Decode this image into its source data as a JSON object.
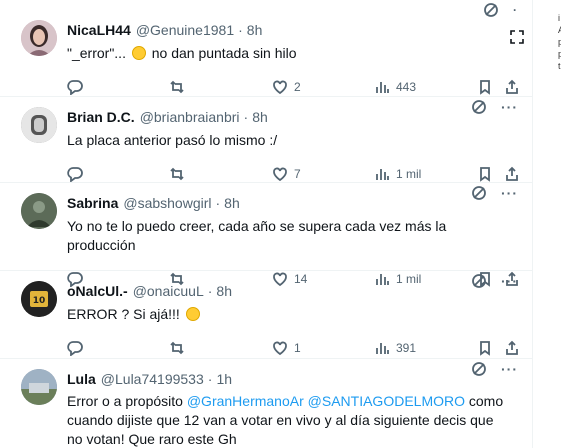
{
  "tweets": [
    {
      "name": "NicaLH44",
      "handle": "@Genuine1981",
      "time": "8h",
      "text_before": "\"_error\"... ",
      "text_after": " no dan puntada sin hilo",
      "replies": "",
      "retweets": "",
      "likes": "2",
      "views": "443",
      "avatar_color": "#c9a9b4"
    },
    {
      "name": "Brian D.C.",
      "handle": "@brianbraianbri",
      "time": "8h",
      "text": "La placa anterior pasó lo mismo :/",
      "replies": "",
      "retweets": "",
      "likes": "7",
      "views": "1 mil",
      "avatar_color": "#a7a7a7"
    },
    {
      "name": "Sabrina",
      "handle": "@sabshowgirl",
      "time": "8h",
      "text": "Yo no te lo puedo creer, cada año se supera cada vez más la producción",
      "replies": "",
      "retweets": "",
      "likes": "14",
      "views": "1 mil",
      "avatar_color": "#4d5a4a"
    },
    {
      "name": "oNalcUl.-",
      "handle": "@onaicuuL",
      "time": "8h",
      "text_before": "ERROR ? Si ajá!!! ",
      "replies": "",
      "retweets": "",
      "likes": "1",
      "views": "391",
      "avatar_color": "#2a2a2a"
    },
    {
      "name": "Lula",
      "handle": "@Lula74199533",
      "time": "1h",
      "text_before": "Error o a propósito ",
      "mention1": "@GranHermanoAr",
      "mention2": "@SANTIAGODELMORO",
      "text_after": " como cuando dijiste que 12 van a votar  en vivo y al día siguiente decis que no votan! Que raro este Gh",
      "avatar_color": "#7a8fa8"
    }
  ],
  "side_fragments": [
    "i",
    "A",
    "p",
    "p",
    "t"
  ],
  "icons": {
    "grok": "grok-icon",
    "more": "more-icon",
    "reply": "reply-icon",
    "retweet": "retweet-icon",
    "like": "heart-icon",
    "views": "views-icon",
    "bookmark": "bookmark-icon",
    "share": "share-icon",
    "expand": "expand-icon"
  },
  "colors": {
    "link": "#1d9bf0",
    "secondary": "#536471",
    "border": "#eff3f4"
  }
}
